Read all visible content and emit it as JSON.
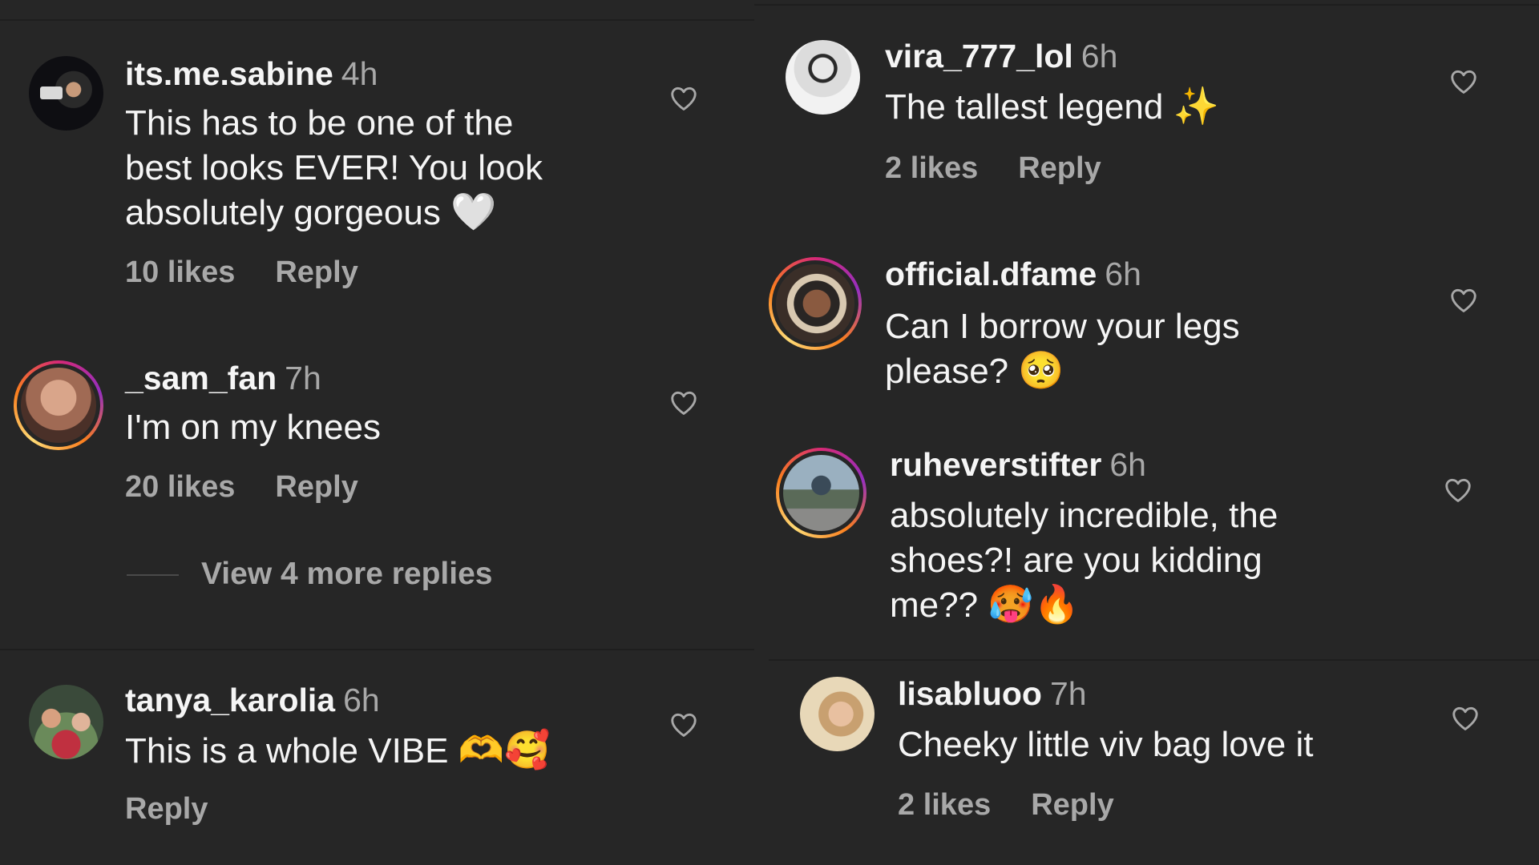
{
  "left": {
    "comments": [
      {
        "username": "its.me.sabine",
        "time": "4h",
        "text": "This has to be one of the\nbest looks EVER! You look\nabsolutely gorgeous",
        "emoji": "🤍",
        "likes": "10 likes",
        "reply": "Reply"
      },
      {
        "username": "_sam_fan",
        "time": "7h",
        "text": "I'm on my knees",
        "likes": "20 likes",
        "reply": "Reply"
      },
      {
        "username": "tanya_karolia",
        "time": "6h",
        "text": "This is a whole VIBE",
        "emoji": "🫶🥰",
        "reply": "Reply"
      }
    ],
    "view_more": "View 4 more replies"
  },
  "right": {
    "comments": [
      {
        "username": "vira_777_lol",
        "time": "6h",
        "text": "The tallest legend",
        "emoji": "✨",
        "likes": "2 likes",
        "reply": "Reply"
      },
      {
        "username": "official.dfame",
        "time": "6h",
        "text": "Can I borrow your legs\nplease?",
        "emoji": "🥺"
      },
      {
        "username": "ruheverstifter",
        "time": "6h",
        "text": "absolutely incredible, the\nshoes?! are you kidding\nme??",
        "emoji": "🥵🔥"
      },
      {
        "username": "lisabluoo",
        "time": "7h",
        "text": "Cheeky little viv bag love it",
        "likes": "2 likes",
        "reply": "Reply"
      }
    ]
  },
  "icons": {
    "like": "heart-outline-icon"
  },
  "colors": {
    "background": "#262626",
    "primary_text": "#f5f5f5",
    "secondary_text": "#a8a8a8",
    "story_ring": "#d62976"
  }
}
